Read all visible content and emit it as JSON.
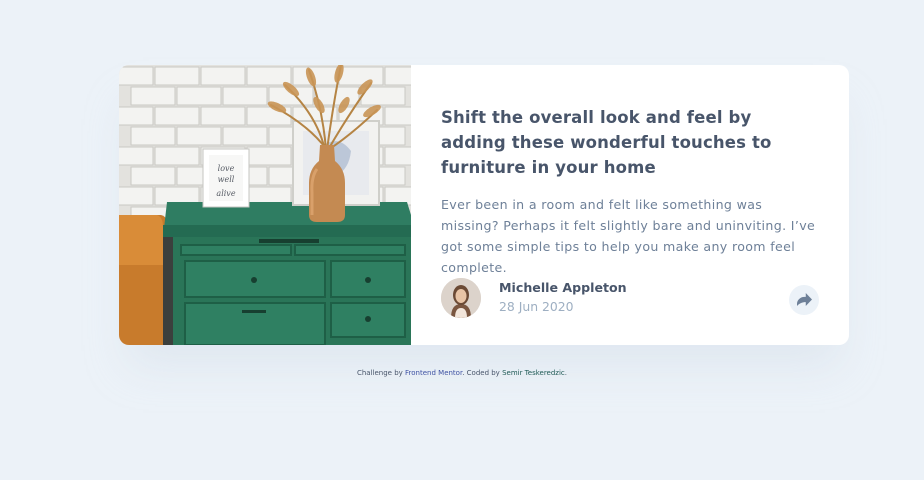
{
  "article": {
    "title": "Shift the overall look and feel by adding these wonderful touches to furniture in your home",
    "description": "Ever been in a room and felt like something was missing? Perhaps it felt slightly bare and uninviting. I’ve got some simple tips to help you make any room feel complete.",
    "image": {
      "frame_text_line1": "love",
      "frame_text_line2": "well",
      "frame_text_line3": "alive"
    }
  },
  "author": {
    "name": "Michelle Appleton",
    "date": "28 Jun 2020"
  },
  "share": {
    "icon": "share-icon"
  },
  "attribution": {
    "prefix": "Challenge by ",
    "challenge_link": "Frontend Mentor",
    "middle": ". Coded by ",
    "dev_link": "Semir Teskeredzic",
    "suffix": "."
  },
  "colors": {
    "background": "#ecf2f8",
    "card": "#ffffff",
    "title": "#48556a",
    "text": "#6e8098",
    "muted": "#9eafc2",
    "dresser": "#2d7a5f"
  }
}
